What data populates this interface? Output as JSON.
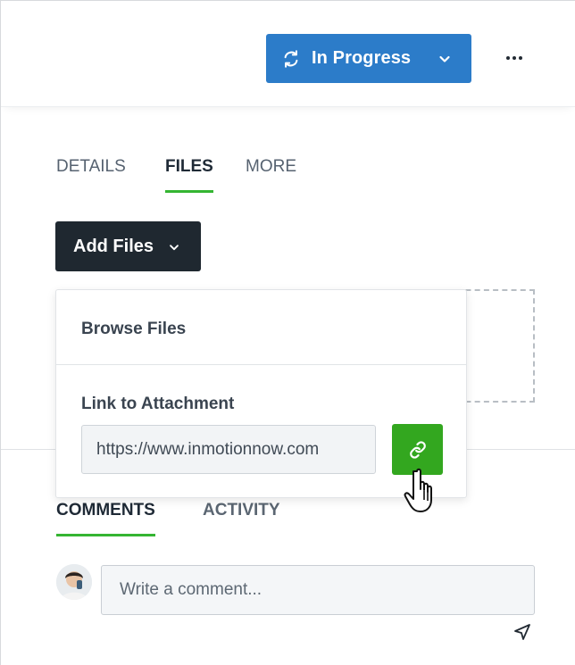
{
  "header": {
    "status_label": "In Progress",
    "more_label": "···"
  },
  "tabs_top": [
    {
      "label": "DETAILS",
      "active": false
    },
    {
      "label": "FILES",
      "active": true
    },
    {
      "label": "MORE",
      "active": false
    }
  ],
  "add_files": {
    "label": "Add Files"
  },
  "dropdown": {
    "browse_label": "Browse Files",
    "link_label": "Link to Attachment",
    "url_value": "https://www.inmotionnow.com"
  },
  "tabs_bottom": [
    {
      "label": "COMMENTS",
      "active": true
    },
    {
      "label": "ACTIVITY",
      "active": false
    }
  ],
  "comment": {
    "placeholder": "Write a comment..."
  },
  "colors": {
    "primary_blue": "#2c7cc9",
    "accent_green": "#35b532",
    "link_button_green": "#33a71f",
    "dark_button": "#1f2830"
  },
  "icons": [
    "sync-icon",
    "chevron-down-icon",
    "more-icon",
    "link-icon",
    "hand-cursor-icon",
    "send-icon",
    "avatar"
  ]
}
